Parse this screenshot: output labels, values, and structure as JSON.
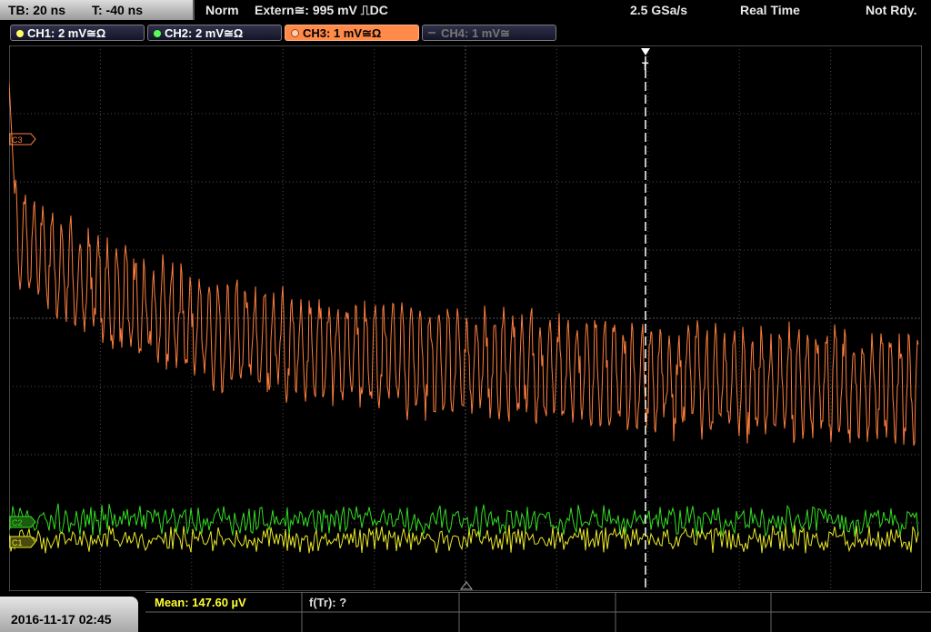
{
  "topbar": {
    "timebase": "TB: 20 ns",
    "trigger_time": "T: -40 ns",
    "mode": "Norm",
    "trigger": "Extern≅: 995 mV ⎍DC",
    "sample_rate": "2.5 GSa/s",
    "acq_mode": "Real Time",
    "status": "Not Rdy."
  },
  "channels": [
    {
      "label": "CH1: 2 mV≅Ω",
      "color": "#ffff33",
      "active": true
    },
    {
      "label": "CH2: 2 mV≅Ω",
      "color": "#33ff33",
      "active": true
    },
    {
      "label": "CH3: 1 mV≅Ω",
      "color": "#ff8844",
      "active": true
    },
    {
      "label": "CH4: 1 mV≅",
      "color": "#666666",
      "active": false
    }
  ],
  "markers": {
    "ch3": "C3",
    "ch2": "C2",
    "ch1": "C1",
    "trigger": "T"
  },
  "colors": {
    "grid": "#555555",
    "ch1": "#e8e82a",
    "ch2": "#33dd22",
    "ch3": "#ff7f3f",
    "ch3_label_bg": "#ff7f3f"
  },
  "measurements": {
    "mean": "Mean: 147.60 µV",
    "ftr": "f(Tr): ?"
  },
  "datetime": "2016-11-17 02:45"
}
